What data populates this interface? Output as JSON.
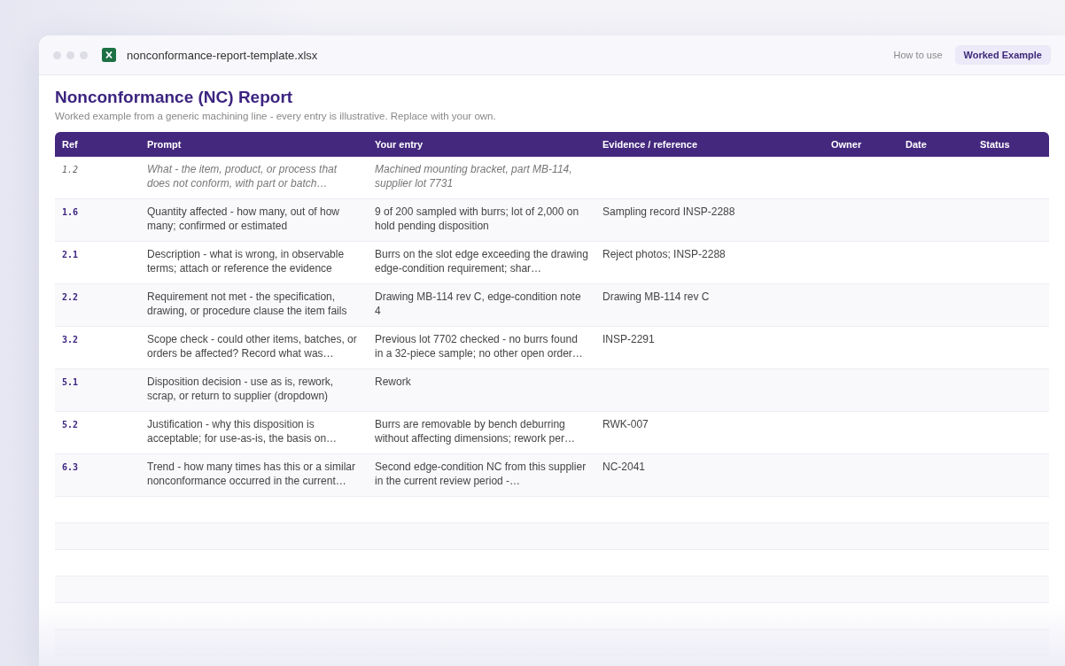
{
  "window": {
    "title": "nonconformance-report-template.xlsx"
  },
  "tabs": [
    {
      "label": "How to use",
      "selected": false
    },
    {
      "label": "Worked Example",
      "selected": true
    }
  ],
  "report": {
    "title": "Nonconformance (NC) Report",
    "subtitle": "Worked example from a generic machining line - every entry is illustrative. Replace with your own."
  },
  "table": {
    "columns": [
      "Ref",
      "Prompt",
      "Your entry",
      "Evidence / reference",
      "Owner",
      "Date",
      "Status"
    ],
    "rows": [
      {
        "kind": "hint",
        "ref": "1.2",
        "prompt": "What - the item, product, or process that does not conform, with part or batch…",
        "entry": "Machined mounting bracket, part MB-114, supplier lot 7731"
      },
      {
        "kind": "entry",
        "ref": "1.6",
        "prompt": "Quantity affected - how many, out of how many; confirmed or estimated",
        "entry": "9 of 200 sampled with burrs; lot of 2,000 on hold pending disposition",
        "evidence": "Sampling record INSP-2288"
      },
      {
        "kind": "entry",
        "ref": "2.1",
        "prompt": "Description - what is wrong, in observable terms; attach or reference the evidence",
        "entry": "Burrs on the slot edge exceeding the drawing edge-condition requirement; shar…",
        "evidence": "Reject photos; INSP-2288"
      },
      {
        "kind": "entry",
        "ref": "2.2",
        "prompt": "Requirement not met - the specification, drawing, or procedure clause the item fails",
        "entry": "Drawing MB-114 rev C, edge-condition note 4",
        "evidence": "Drawing MB-114 rev C"
      },
      {
        "kind": "entry",
        "ref": "3.2",
        "prompt": "Scope check - could other items, batches, or orders be affected? Record what was…",
        "entry": "Previous lot 7702 checked - no burrs found in a 32-piece sample; no other open order…",
        "evidence": "INSP-2291"
      },
      {
        "kind": "entry",
        "ref": "5.1",
        "prompt": "Disposition decision - use as is, rework, scrap, or return to supplier (dropdown)",
        "entry": "Rework"
      },
      {
        "kind": "entry",
        "ref": "5.2",
        "prompt": "Justification - why this disposition is acceptable; for use-as-is, the basis on…",
        "entry": "Burrs are removable by bench deburring without affecting dimensions; rework per…",
        "evidence": "RWK-007"
      },
      {
        "kind": "entry",
        "ref": "6.3",
        "prompt": "Trend - how many times has this or a similar nonconformance occurred in the current…",
        "entry": "Second edge-condition NC from this supplier in the current review period -…",
        "evidence": "NC-2041"
      }
    ]
  }
}
